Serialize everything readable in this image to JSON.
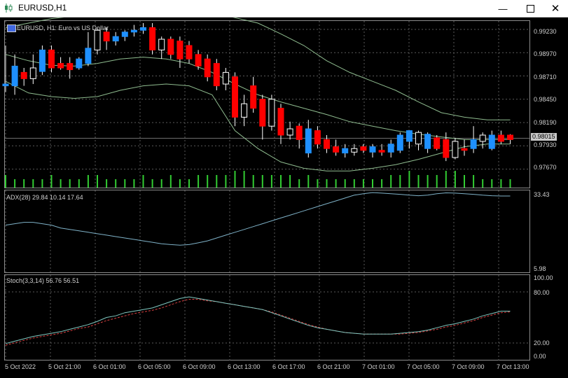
{
  "window": {
    "title": "EURUSD,H1",
    "minimize_icon": "minimize-icon",
    "maximize_icon": "maximize-icon",
    "close_icon": "close-icon"
  },
  "main_pane": {
    "label": "EURUSD, H1:  Euro vs US Dollar",
    "price_ticks": [
      "0.99230",
      "0.98970",
      "0.98710",
      "0.98450",
      "0.98190",
      "0.97930",
      "0.97670"
    ],
    "current_price": "0.98015",
    "colors": {
      "bull": "#1e90ff",
      "bear": "#ff0000",
      "doji": "#ffffff",
      "bands": "#8fbc8f",
      "volume": "#32cd32"
    }
  },
  "adx_pane": {
    "label": "ADX(28) 29.84 10.14 17.64",
    "ticks": [
      "33.43",
      "5.98"
    ]
  },
  "stoch_pane": {
    "label": "Stoch(3,3,14) 56.76 56.51",
    "ticks": [
      "100.00",
      "80.00",
      "20.00",
      "0.00"
    ]
  },
  "time_axis": [
    "5 Oct 2022",
    "5 Oct 21:00",
    "6 Oct 01:00",
    "6 Oct 05:00",
    "6 Oct 09:00",
    "6 Oct 13:00",
    "6 Oct 17:00",
    "6 Oct 21:00",
    "7 Oct 01:00",
    "7 Oct 05:00",
    "7 Oct 09:00",
    "7 Oct 13:00"
  ],
  "chart_data": {
    "type": "candlestick",
    "symbol": "EURUSD",
    "timeframe": "H1",
    "ylim": [
      0.9755,
      0.993
    ],
    "candles": [
      {
        "o": 0.986,
        "h": 0.9905,
        "l": 0.9853,
        "c": 0.9862
      },
      {
        "o": 0.986,
        "h": 0.9895,
        "l": 0.985,
        "c": 0.9882
      },
      {
        "o": 0.9875,
        "h": 0.988,
        "l": 0.986,
        "c": 0.9868
      },
      {
        "o": 0.9868,
        "h": 0.9895,
        "l": 0.9862,
        "c": 0.988
      },
      {
        "o": 0.9876,
        "h": 0.9905,
        "l": 0.9872,
        "c": 0.99
      },
      {
        "o": 0.99,
        "h": 0.9905,
        "l": 0.9875,
        "c": 0.988
      },
      {
        "o": 0.9885,
        "h": 0.9892,
        "l": 0.9878,
        "c": 0.988
      },
      {
        "o": 0.9885,
        "h": 0.9892,
        "l": 0.9868,
        "c": 0.9878
      },
      {
        "o": 0.988,
        "h": 0.9892,
        "l": 0.9878,
        "c": 0.989
      },
      {
        "o": 0.9885,
        "h": 0.992,
        "l": 0.9882,
        "c": 0.9902
      },
      {
        "o": 0.99,
        "h": 0.9925,
        "l": 0.9895,
        "c": 0.9922
      },
      {
        "o": 0.992,
        "h": 0.9925,
        "l": 0.99,
        "c": 0.991
      },
      {
        "o": 0.991,
        "h": 0.992,
        "l": 0.9905,
        "c": 0.9915
      },
      {
        "o": 0.9915,
        "h": 0.9922,
        "l": 0.991,
        "c": 0.992
      },
      {
        "o": 0.992,
        "h": 0.9928,
        "l": 0.9915,
        "c": 0.9922
      },
      {
        "o": 0.9922,
        "h": 0.993,
        "l": 0.9918,
        "c": 0.9925
      },
      {
        "o": 0.9925,
        "h": 0.993,
        "l": 0.9895,
        "c": 0.99
      },
      {
        "o": 0.99,
        "h": 0.9915,
        "l": 0.989,
        "c": 0.9912
      },
      {
        "o": 0.9912,
        "h": 0.9915,
        "l": 0.989,
        "c": 0.9895
      },
      {
        "o": 0.991,
        "h": 0.9915,
        "l": 0.988,
        "c": 0.989
      },
      {
        "o": 0.9905,
        "h": 0.991,
        "l": 0.9885,
        "c": 0.989
      },
      {
        "o": 0.9895,
        "h": 0.99,
        "l": 0.9878,
        "c": 0.9882
      },
      {
        "o": 0.989,
        "h": 0.9895,
        "l": 0.9865,
        "c": 0.987
      },
      {
        "o": 0.9885,
        "h": 0.989,
        "l": 0.9855,
        "c": 0.986
      },
      {
        "o": 0.9875,
        "h": 0.988,
        "l": 0.9855,
        "c": 0.9862
      },
      {
        "o": 0.987,
        "h": 0.9875,
        "l": 0.9815,
        "c": 0.9825
      },
      {
        "o": 0.9825,
        "h": 0.985,
        "l": 0.9815,
        "c": 0.984
      },
      {
        "o": 0.986,
        "h": 0.987,
        "l": 0.983,
        "c": 0.9835
      },
      {
        "o": 0.9845,
        "h": 0.985,
        "l": 0.98,
        "c": 0.9815
      },
      {
        "o": 0.9815,
        "h": 0.985,
        "l": 0.981,
        "c": 0.9845
      },
      {
        "o": 0.9835,
        "h": 0.984,
        "l": 0.9795,
        "c": 0.9805
      },
      {
        "o": 0.9805,
        "h": 0.982,
        "l": 0.98,
        "c": 0.9812
      },
      {
        "o": 0.9815,
        "h": 0.9818,
        "l": 0.979,
        "c": 0.98
      },
      {
        "o": 0.9785,
        "h": 0.9822,
        "l": 0.978,
        "c": 0.9812
      },
      {
        "o": 0.981,
        "h": 0.9815,
        "l": 0.979,
        "c": 0.9795
      },
      {
        "o": 0.98,
        "h": 0.9805,
        "l": 0.9785,
        "c": 0.979
      },
      {
        "o": 0.9792,
        "h": 0.98,
        "l": 0.9782,
        "c": 0.9786
      },
      {
        "o": 0.9785,
        "h": 0.9795,
        "l": 0.978,
        "c": 0.979
      },
      {
        "o": 0.979,
        "h": 0.9795,
        "l": 0.9782,
        "c": 0.9786
      },
      {
        "o": 0.9792,
        "h": 0.9795,
        "l": 0.9785,
        "c": 0.9788
      },
      {
        "o": 0.9786,
        "h": 0.9795,
        "l": 0.978,
        "c": 0.9792
      },
      {
        "o": 0.9788,
        "h": 0.9795,
        "l": 0.9782,
        "c": 0.9786
      },
      {
        "o": 0.9786,
        "h": 0.98,
        "l": 0.978,
        "c": 0.9795
      },
      {
        "o": 0.9788,
        "h": 0.9808,
        "l": 0.9785,
        "c": 0.9805
      },
      {
        "o": 0.9798,
        "h": 0.981,
        "l": 0.979,
        "c": 0.981
      },
      {
        "o": 0.9808,
        "h": 0.981,
        "l": 0.9788,
        "c": 0.9795
      },
      {
        "o": 0.979,
        "h": 0.9808,
        "l": 0.9785,
        "c": 0.9806
      },
      {
        "o": 0.9802,
        "h": 0.9805,
        "l": 0.9788,
        "c": 0.979
      },
      {
        "o": 0.98,
        "h": 0.9808,
        "l": 0.9776,
        "c": 0.978
      },
      {
        "o": 0.978,
        "h": 0.9802,
        "l": 0.9778,
        "c": 0.9798
      },
      {
        "o": 0.979,
        "h": 0.98,
        "l": 0.9782,
        "c": 0.9788
      },
      {
        "o": 0.979,
        "h": 0.9815,
        "l": 0.9785,
        "c": 0.98
      },
      {
        "o": 0.9798,
        "h": 0.9808,
        "l": 0.979,
        "c": 0.9805
      },
      {
        "o": 0.979,
        "h": 0.981,
        "l": 0.9788,
        "c": 0.9805
      },
      {
        "o": 0.9805,
        "h": 0.981,
        "l": 0.9795,
        "c": 0.9798
      },
      {
        "o": 0.9805,
        "h": 0.9806,
        "l": 0.9795,
        "c": 0.98
      }
    ],
    "bollinger_upper": [
      0.9925,
      0.993,
      0.9935,
      0.9938,
      0.994,
      0.9942,
      0.9945,
      0.9946,
      0.9945,
      0.9942,
      0.9936,
      0.993,
      0.9918,
      0.9905,
      0.9888,
      0.9875,
      0.9865,
      0.9855,
      0.9842,
      0.983,
      0.9825,
      0.9822,
      0.9822
    ],
    "bollinger_middle": [
      0.9895,
      0.9888,
      0.9883,
      0.9882,
      0.9885,
      0.989,
      0.9892,
      0.989,
      0.9885,
      0.9875,
      0.9862,
      0.985,
      0.9842,
      0.9835,
      0.9828,
      0.982,
      0.9815,
      0.981,
      0.9806,
      0.9803,
      0.98,
      0.98,
      0.98
    ],
    "bollinger_lower": [
      0.9865,
      0.9852,
      0.9848,
      0.9846,
      0.9848,
      0.9855,
      0.986,
      0.9862,
      0.986,
      0.985,
      0.981,
      0.979,
      0.9775,
      0.9768,
      0.9765,
      0.9765,
      0.9768,
      0.9772,
      0.9778,
      0.9785,
      0.9792,
      0.9795,
      0.9795
    ],
    "volumes": [
      3,
      2,
      2,
      2,
      2,
      3,
      2,
      2,
      2,
      3,
      3,
      2,
      2,
      2,
      2,
      3,
      2,
      2,
      3,
      2,
      2,
      3,
      3,
      3,
      3,
      4,
      4,
      3,
      3,
      3,
      3,
      3,
      2,
      3,
      2,
      2,
      2,
      2,
      2,
      2,
      2,
      2,
      3,
      3,
      4,
      3,
      3,
      3,
      4,
      4,
      3,
      3,
      2,
      2,
      2,
      2
    ],
    "adx": [
      22,
      22.5,
      23,
      23,
      22.5,
      22,
      21,
      20.5,
      20,
      19.5,
      19,
      18.5,
      18,
      17.5,
      17,
      16.5,
      16,
      15.5,
      15.2,
      15,
      15.2,
      15.8,
      16.5,
      17.5,
      18.5,
      19.5,
      20.5,
      21.5,
      22.5,
      23.5,
      24.5,
      25.5,
      26.5,
      27.5,
      28.5,
      29.5,
      30.5,
      31.5,
      32.5,
      33,
      33.4,
      33.2,
      33,
      32.8,
      32.5,
      32.3,
      32.5,
      33,
      33.3,
      33.2,
      33,
      32.8,
      32.5,
      32.3,
      32.2,
      32.2
    ],
    "stoch_main": [
      17,
      20,
      23,
      26,
      28,
      30,
      32,
      35,
      38,
      41,
      45,
      50,
      52,
      56,
      58,
      60,
      62,
      66,
      70,
      74,
      76,
      74,
      72,
      70,
      68,
      66,
      64,
      62,
      60,
      56,
      52,
      48,
      44,
      40,
      37,
      35,
      33,
      31,
      30,
      29,
      29,
      29,
      29,
      30,
      31,
      32,
      34,
      37,
      40,
      42,
      45,
      48,
      52,
      55,
      58,
      58
    ],
    "stoch_signal": [
      15,
      18,
      21,
      24,
      26,
      28,
      30,
      33,
      36,
      38,
      42,
      46,
      49,
      52,
      55,
      57,
      59,
      62,
      66,
      70,
      73,
      73,
      71,
      70,
      68,
      66,
      64,
      62,
      60,
      57,
      53,
      49,
      45,
      41,
      38,
      35,
      33,
      31,
      30,
      29,
      29,
      29,
      29,
      29,
      30,
      31,
      33,
      35,
      38,
      40,
      43,
      46,
      50,
      53,
      56,
      57
    ]
  }
}
